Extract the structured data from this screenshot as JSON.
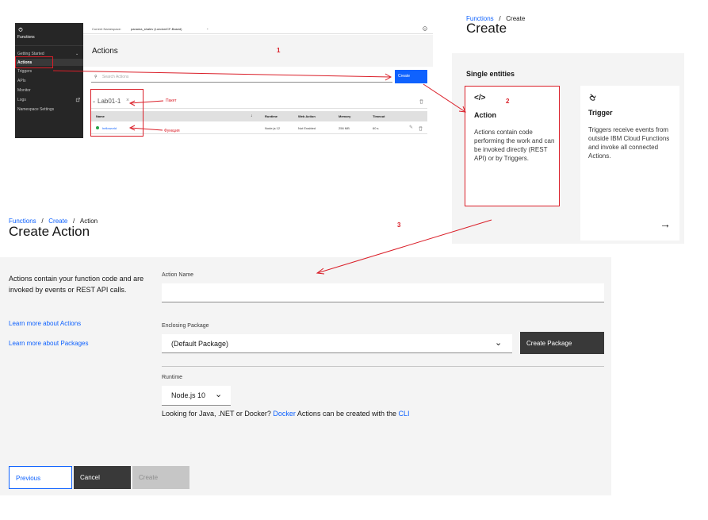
{
  "colors": {
    "accent": "#0f62fe",
    "annotation": "#da1e28",
    "sidebar_bg": "#262626",
    "panel_bg": "#f4f4f4",
    "button_dark": "#393939",
    "status_green": "#24a148"
  },
  "shot1": {
    "sidebar": {
      "logo_icon": "power-icon",
      "app_title": "Functions",
      "items": [
        {
          "label": "Getting Started"
        },
        {
          "label": "Actions"
        },
        {
          "label": "Triggers"
        },
        {
          "label": "APIs"
        },
        {
          "label": "Monitor"
        },
        {
          "label": "Logs"
        },
        {
          "label": "Namespace Settings"
        }
      ]
    },
    "topbar": {
      "namespace_label": "Current Namespace:",
      "namespace_value": "panama_shalev (London/CF-Based)"
    },
    "page_title": "Actions",
    "search_placeholder": "Search Actions",
    "create_button": "Create",
    "package_name": "Lab01-1",
    "table": {
      "headers": [
        "Name",
        "Runtime",
        "Web Action",
        "Memory",
        "Timeout"
      ],
      "row": {
        "name": "helloworld",
        "runtime": "Node.js 12",
        "web_action": "Not Enabled",
        "memory": "256 MB",
        "timeout": "60 s"
      }
    },
    "annotations": {
      "num1": "1",
      "package_note": "Пакет",
      "function_note": "Функция"
    }
  },
  "shot2": {
    "breadcrumb": {
      "root": "Functions",
      "current": "Create"
    },
    "title": "Create",
    "section_title": "Single entities",
    "action_tile": {
      "icon": "code-icon",
      "title": "Action",
      "description": "Actions contain code performing the work and can be invoked directly (REST API) or by Triggers."
    },
    "trigger_tile": {
      "icon": "trigger-icon",
      "title": "Trigger",
      "description": "Triggers receive events from outside IBM Cloud Functions and invoke all connected Actions.",
      "arrow_icon": "arrow-right-icon"
    },
    "annotations": {
      "num2": "2"
    }
  },
  "shot3": {
    "breadcrumb": {
      "root": "Functions",
      "middle": "Create",
      "current": "Action"
    },
    "title": "Create Action",
    "description": "Actions contain your function code and are invoked by events or REST API calls.",
    "links": [
      "Learn more about Actions",
      "Learn more about Packages"
    ],
    "action_name_label": "Action Name",
    "action_name_value": "",
    "package_label": "Enclosing Package",
    "package_value": "(Default Package)",
    "create_package_button": "Create Package",
    "runtime_label": "Runtime",
    "runtime_value": "Node.js 10",
    "footnote": {
      "prefix": "Looking for Java, .NET or Docker? ",
      "docker_link": "Docker",
      "middle": " Actions can be created with the ",
      "cli_link": "CLI"
    },
    "buttons": {
      "previous": "Previous",
      "cancel": "Cancel",
      "create": "Create"
    },
    "annotations": {
      "num3": "3"
    }
  }
}
